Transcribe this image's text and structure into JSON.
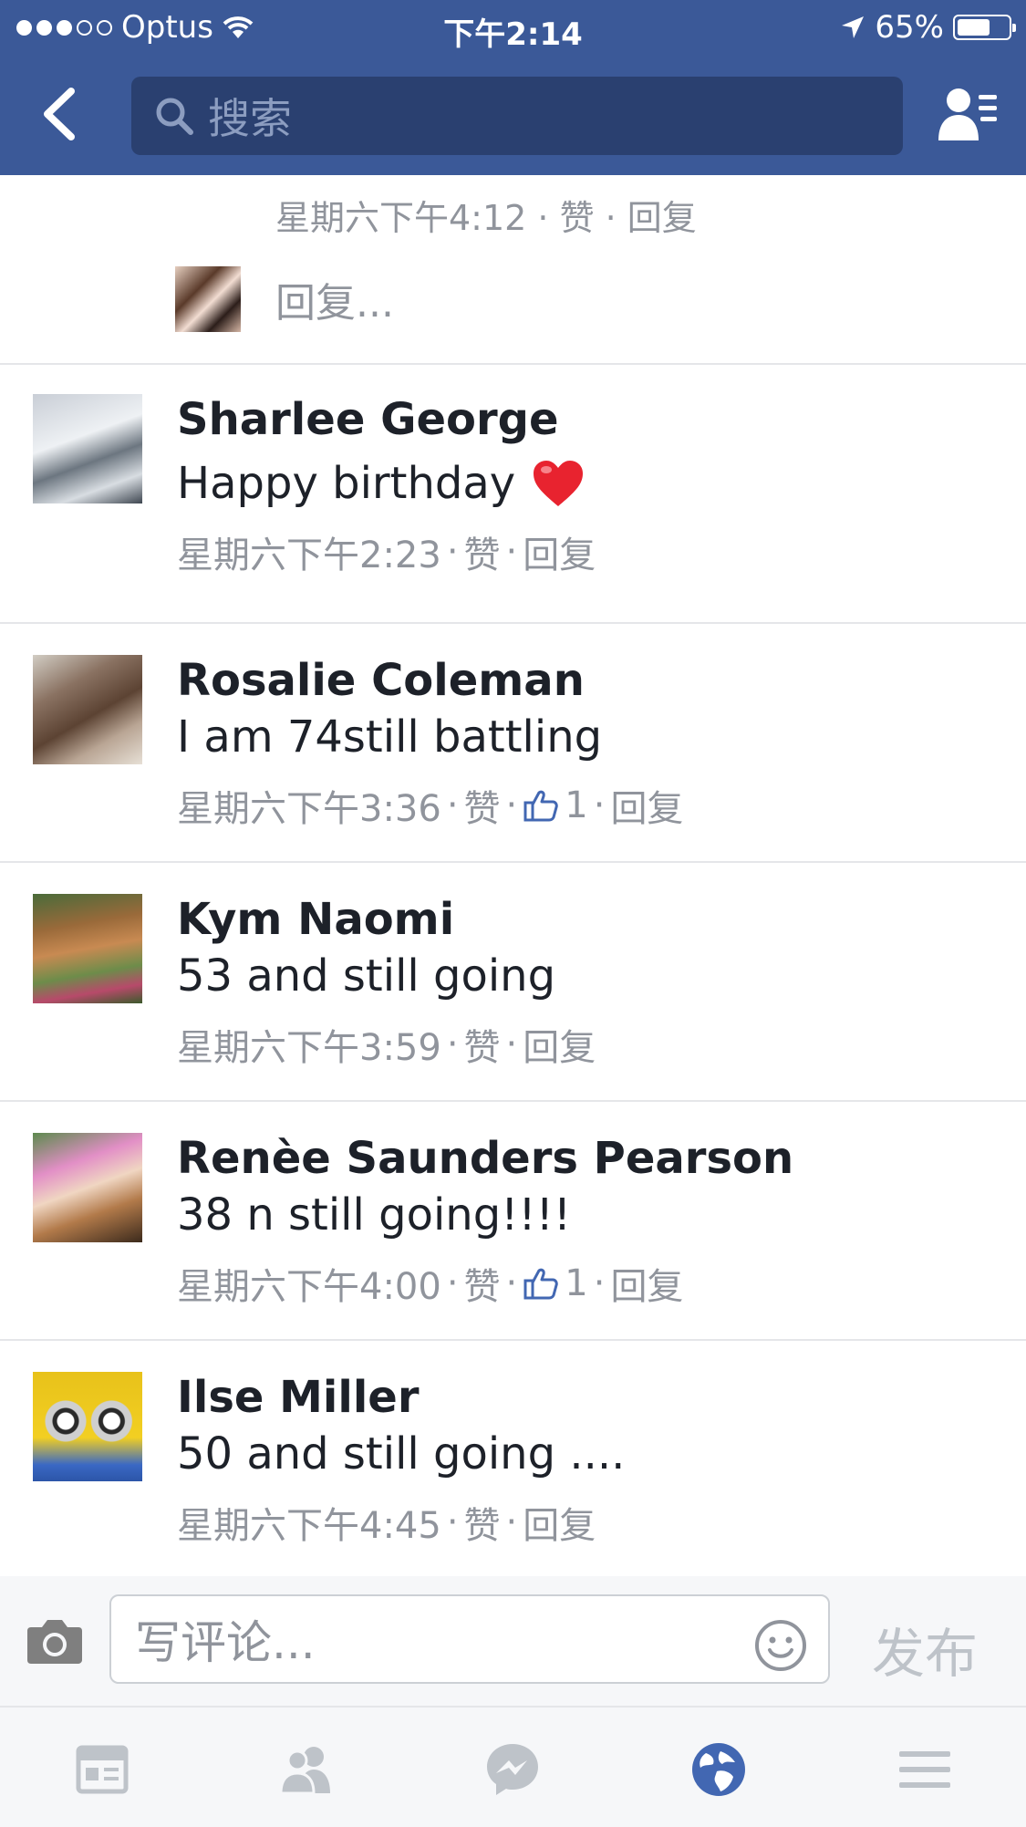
{
  "status_bar": {
    "carrier": "Optus",
    "time": "下午2:14",
    "battery": "65%",
    "battery_level": 0.65
  },
  "nav": {
    "search_placeholder": "搜索"
  },
  "thread_tail": {
    "meta": "星期六下午4:12 · 赞 · 回复",
    "reply_placeholder": "回复..."
  },
  "comments": [
    {
      "name": "Sharlee George",
      "text": "Happy birthday",
      "time": "星期六下午2:23",
      "like": "赞",
      "reply": "回复",
      "likes": ""
    },
    {
      "name": "Rosalie Coleman",
      "text": "I am 74still battling",
      "time": "星期六下午3:36",
      "like": "赞",
      "reply": "回复",
      "likes": "1"
    },
    {
      "name": "Kym Naomi",
      "text": "53 and still going",
      "time": "星期六下午3:59",
      "like": "赞",
      "reply": "回复",
      "likes": ""
    },
    {
      "name": "Renèe Saunders Pearson",
      "text": "38 n still going!!!!",
      "time": "星期六下午4:00",
      "like": "赞",
      "reply": "回复",
      "likes": "1"
    },
    {
      "name": "Ilse Miller",
      "text": "50 and still going ....",
      "time": "星期六下午4:45",
      "like": "赞",
      "reply": "回复",
      "likes": ""
    }
  ],
  "composer": {
    "placeholder": "写评论...",
    "post_label": "发布"
  },
  "tabs": [
    "news-feed-icon",
    "friends-icon",
    "messenger-icon",
    "notifications-globe-icon",
    "menu-icon"
  ],
  "colors": {
    "brand": "#3b5998",
    "meta_gray": "#90949c",
    "active_tab": "#4267b2",
    "inactive_tab": "#bec3c9"
  }
}
